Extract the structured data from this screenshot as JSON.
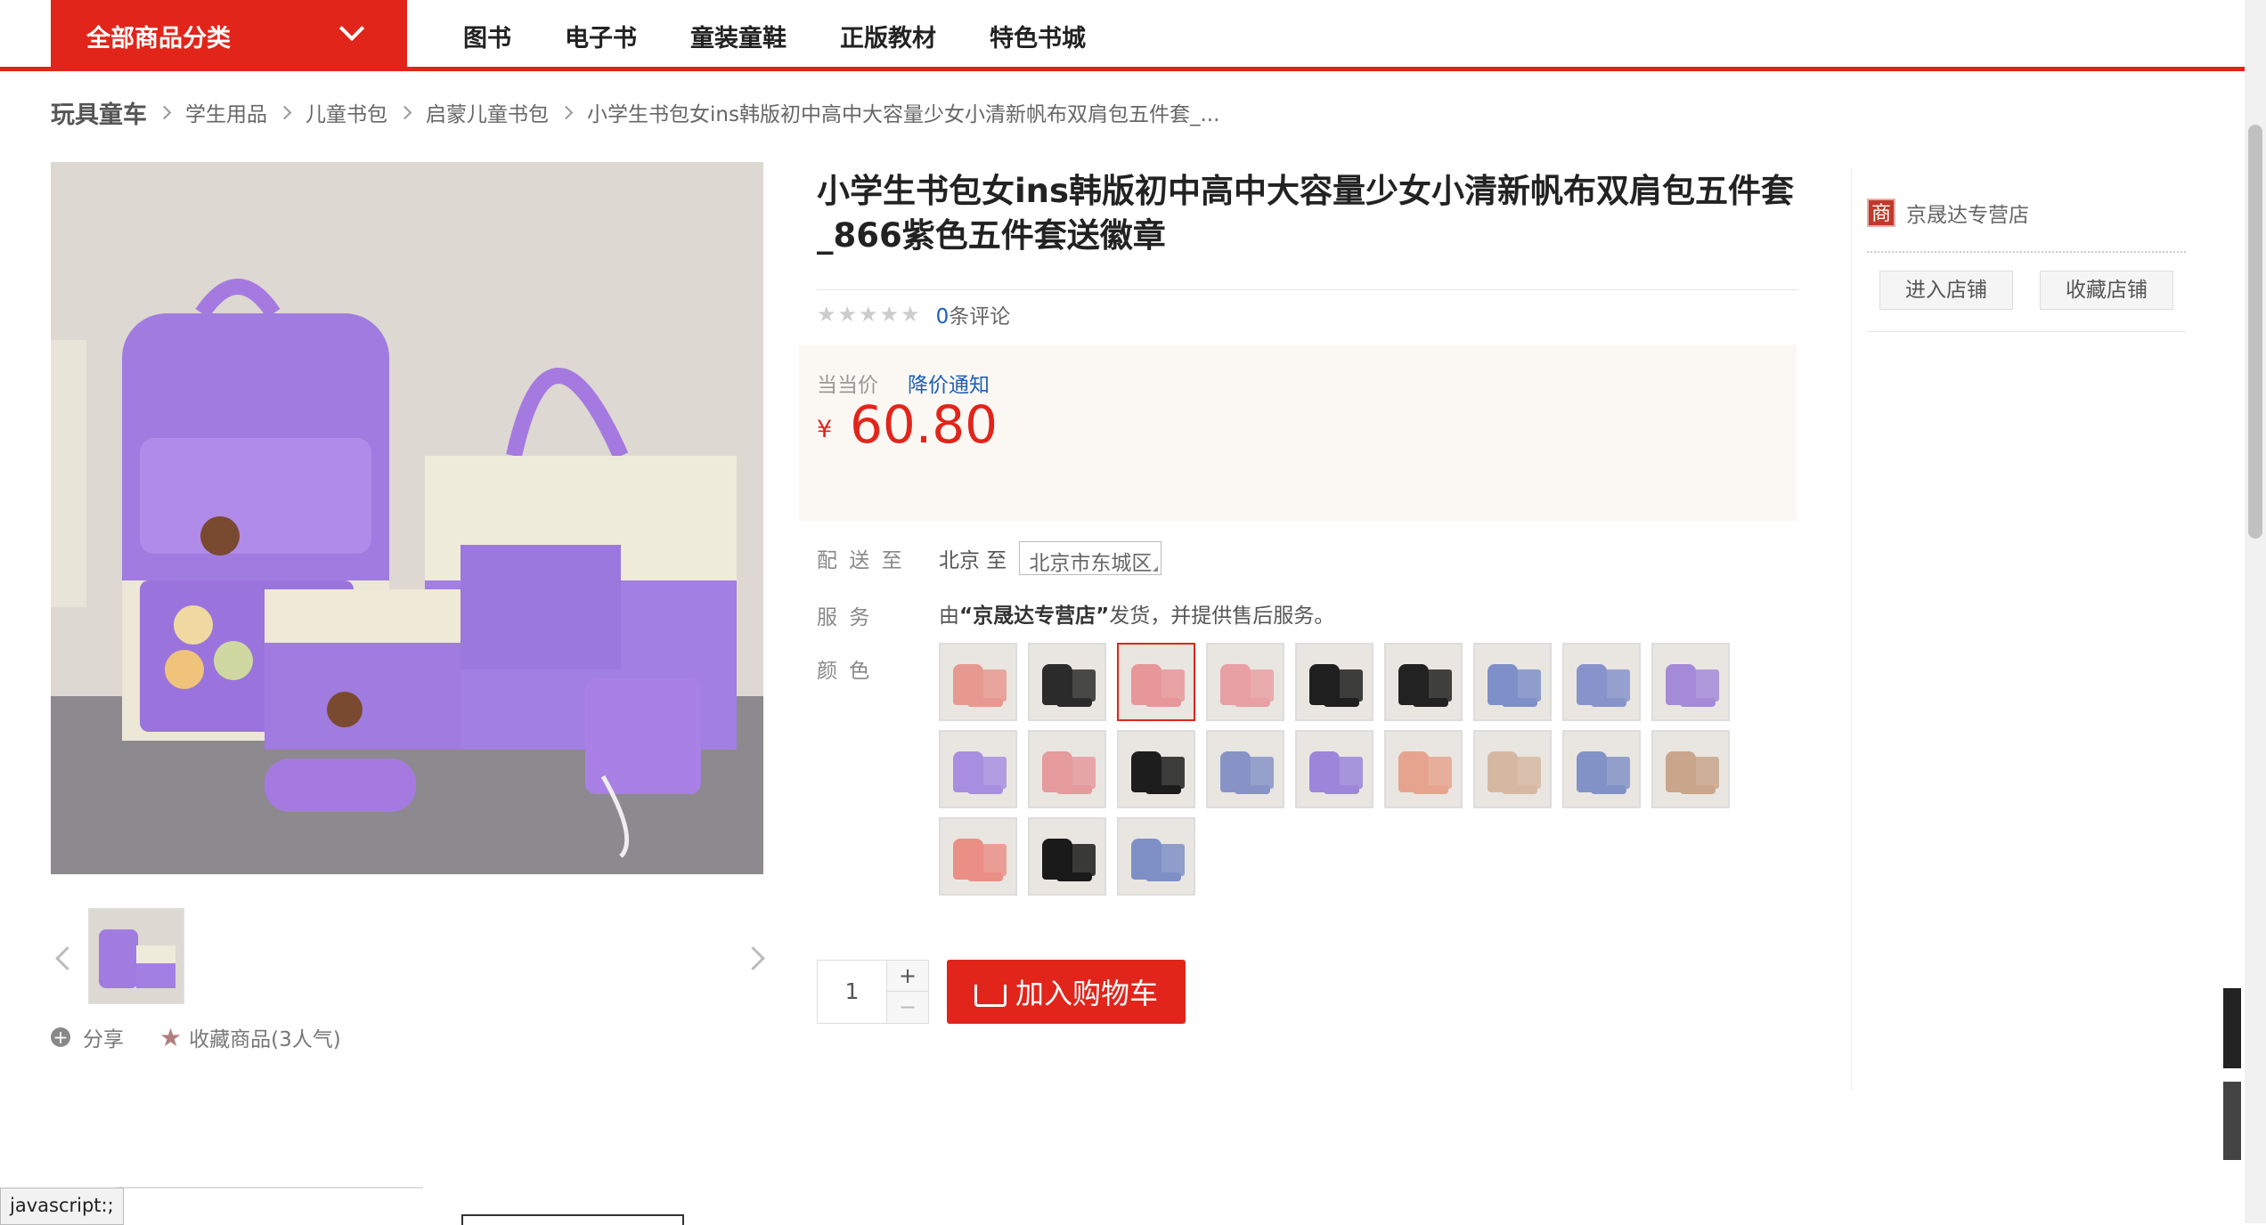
{
  "nav": {
    "all_categories": "全部商品分类",
    "items": [
      "图书",
      "电子书",
      "童装童鞋",
      "正版教材",
      "特色书城"
    ]
  },
  "breadcrumb": {
    "first": "玩具童车",
    "items": [
      "学生用品",
      "儿童书包",
      "启蒙儿童书包",
      "小学生书包女ins韩版初中高中大容量少女小清新帆布双肩包五件套_..."
    ]
  },
  "gallery": {
    "share": "分享",
    "favorite": "收藏商品(3人气)"
  },
  "product": {
    "title_line1": "小学生书包女ins韩版初中高中大容量少女小清新帆布双肩包五件套",
    "title_line2": "_866紫色五件套送徽章",
    "rating_count": "0",
    "rating_suffix": "条评论",
    "price_label": "当当价",
    "price_notify": "降价通知",
    "currency": "¥",
    "price": "60.80",
    "delivery_label": "配 送 至",
    "delivery_from": "北京 至",
    "delivery_to": "北京市东城区",
    "service_label": "服 务",
    "service_prefix": "由",
    "service_store": "“京晟达专营店”",
    "service_suffix": "发货，并提供售后服务。",
    "color_label": "颜 色",
    "quantity": "1",
    "qty_plus": "+",
    "qty_minus": "−",
    "add_to_cart": "加入购物车"
  },
  "swatch_colors": [
    "#e8998f",
    "#2b2b2b",
    "#e7969a",
    "#e8a0a4",
    "#1f1f1f",
    "#222222",
    "#7f8fc8",
    "#8794cc",
    "#a58ad8",
    "#a78ee0",
    "#e59a9c",
    "#1d1d1d",
    "#8793c7",
    "#9b86d9",
    "#e6a48e",
    "#d5b8a2",
    "#8392c6",
    "#c9a68b",
    "#ea8f86",
    "#1a1a1a",
    "#7e8fc6"
  ],
  "selected_swatch_index": 2,
  "shop": {
    "badge": "商",
    "name": "京晟达专营店",
    "enter": "进入店铺",
    "favorite": "收藏店铺"
  },
  "status_bar": "javascript:;",
  "colors": {
    "accent": "#e1251b",
    "link": "#1d60b7",
    "price_bg": "#fbf8f3"
  }
}
